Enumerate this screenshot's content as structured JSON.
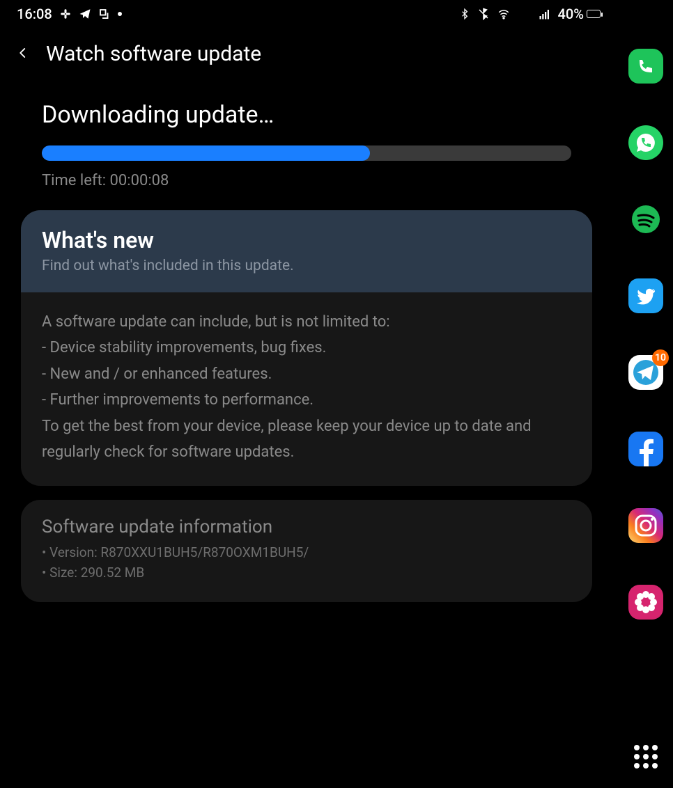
{
  "statusbar": {
    "time": "16:08",
    "battery_pct": "40%"
  },
  "header": {
    "title": "Watch software update"
  },
  "download": {
    "title": "Downloading update…",
    "progress_pct": 62,
    "time_left_label": "Time left: 00:00:08"
  },
  "whats_new": {
    "title": "What's new",
    "subtitle": "Find out what's included in this update.",
    "intro": "A software update can include, but is not limited to:",
    "bullets": [
      " - Device stability improvements, bug fixes.",
      " - New and / or enhanced features.",
      " - Further improvements to performance."
    ],
    "outro": "To get the best from your device, please keep your device up to date and regularly check for software updates."
  },
  "info": {
    "title": "Software update information",
    "version_line": "• Version: R870XXU1BUH5/R870OXM1BUH5/",
    "size_line": "• Size: 290.52 MB"
  },
  "edge": {
    "telegram_badge": "10"
  }
}
